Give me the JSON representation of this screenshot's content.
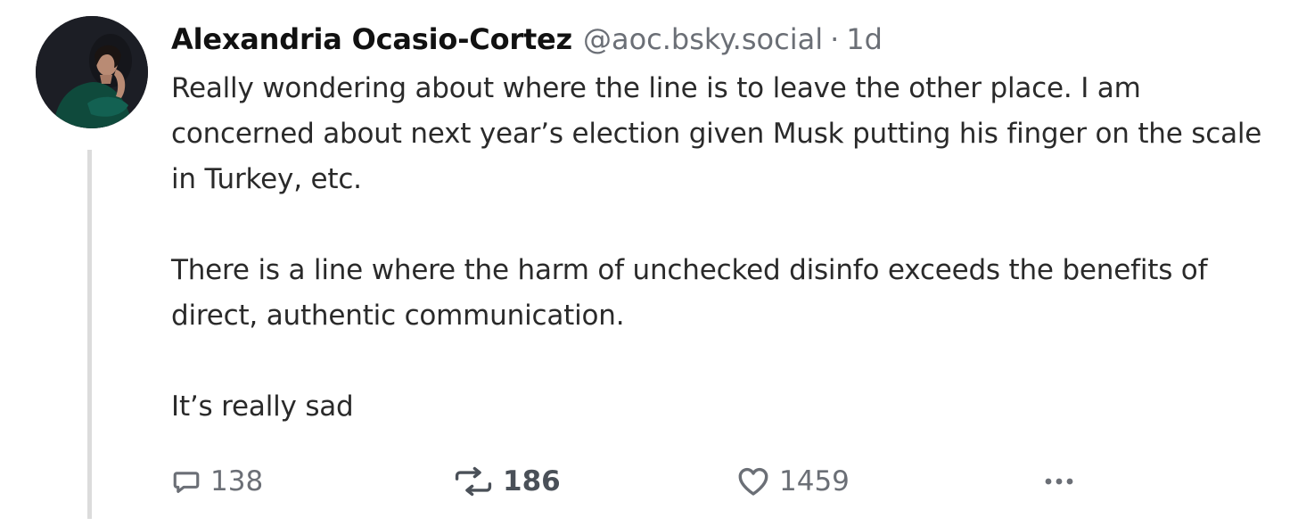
{
  "post": {
    "author": {
      "display_name": "Alexandria Ocasio-Cortez",
      "handle": "@aoc.bsky.social",
      "avatar_icon": "profile-photo"
    },
    "separator": "·",
    "time_ago": "1d",
    "paragraphs": [
      "Really wondering about where the line is to leave the other place. I am concerned about next year’s election given Musk putting his finger on the scale in Turkey, etc.",
      "There is a line where the harm of unchecked disinfo exceeds the benefits of direct, authentic communication.",
      "It’s really sad"
    ],
    "actions": {
      "reply": {
        "icon": "speech-bubble-icon",
        "count": "138"
      },
      "repost": {
        "icon": "repost-arrows-icon",
        "count": "186"
      },
      "like": {
        "icon": "heart-icon",
        "count": "1459"
      },
      "more": {
        "icon": "ellipsis-icon"
      }
    }
  },
  "colors": {
    "text": "#2a2a2a",
    "muted": "#6b6f76",
    "thread_line": "#dcdcdc",
    "background": "#ffffff"
  }
}
